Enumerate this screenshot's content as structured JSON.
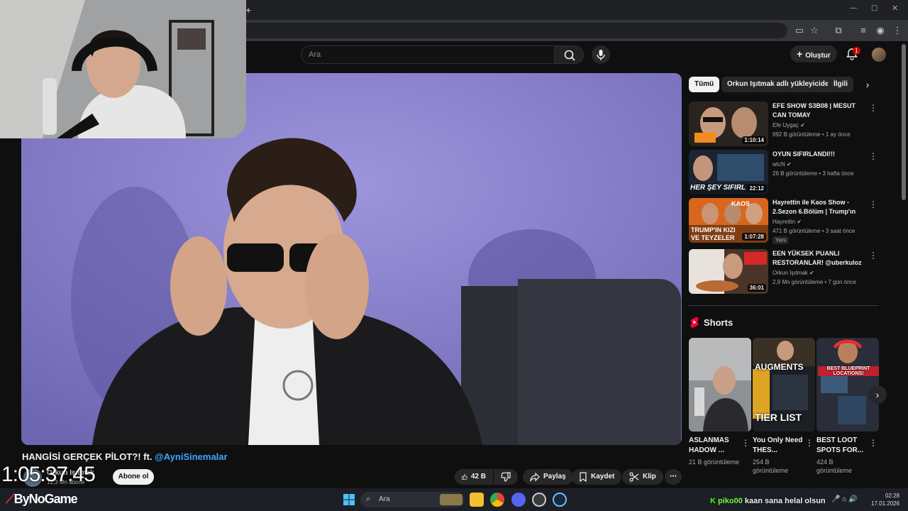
{
  "search": {
    "placeholder": "Ara"
  },
  "header": {
    "create_label": "Oluştur",
    "notif_count": "1"
  },
  "video": {
    "title": "HANGİSİ GERÇEK PİLOT?! ft.",
    "title_mention": "@AyniSinemalar",
    "channel": "Orkun Işıtmak",
    "subs": "12,3 Mn abone",
    "subscribe_label": "Abone ol",
    "likes": "42 B",
    "share_label": "Paylaş",
    "save_label": "Kaydet",
    "clip_label": "Klip"
  },
  "overlay": {
    "timer": "1:05:37.45",
    "brand": "ByNoGame"
  },
  "chips": [
    {
      "label": "Tümü"
    },
    {
      "label": "Orkun Işıtmak adlı yükleyiciden"
    },
    {
      "label": "İlgili"
    }
  ],
  "recommendations": [
    {
      "title": "EFE SHOW S3B08 | MESUT CAN TOMAY",
      "channel": "Efe Uygaç",
      "meta": "992 B görüntüleme • 1 ay önce",
      "duration": "1:10:14"
    },
    {
      "title": "OYUN SIFIRLANDI!!!",
      "channel": "wtcN",
      "meta": "26 B görüntüleme • 3 hafta önce",
      "duration": "22:12"
    },
    {
      "title": "Hayrettin ile Kaos Show - 2.Sezon 6.Bölüm | Trump'ın Kı...",
      "channel": "Hayrettin",
      "meta": "471 B görüntüleme • 3 saat önce",
      "duration": "1:07:28",
      "badge": "Yeni"
    },
    {
      "title": "EEN YÜKSEK PUANLI RESTORANLAR! @uberkuloz ...",
      "channel": "Orkun Işıtmak",
      "meta": "2,9 Mn görüntüleme • 7 gün önce",
      "duration": "36:01"
    }
  ],
  "shorts": {
    "heading": "Shorts",
    "items": [
      {
        "title": "ASLANMAS HADOW ...",
        "views": "21 B görüntüleme"
      },
      {
        "title": "You Only Need THES...",
        "views": "254 B görüntüleme",
        "thumb_text_top": "AUGMENTS",
        "thumb_text_bottom": "TIER LIST"
      },
      {
        "title": "BEST LOOT SPOTS FOR...",
        "views": "424 B görüntüleme",
        "thumb_text_top": "BEST BLUEPRINT LOCATIONS!"
      }
    ]
  },
  "thumb_text": {
    "rec2": "HER ŞEY SIFIRL",
    "rec3a": "TRUMP'IN KIZI",
    "rec3b": "VE TEYZELER",
    "rec3c": "KAOS"
  },
  "taskbar": {
    "search_placeholder": "Ara",
    "chat_user": "piko00",
    "chat_msg": "kaan sana helal olsun",
    "time": "02:28",
    "date": "17.01.2026"
  }
}
